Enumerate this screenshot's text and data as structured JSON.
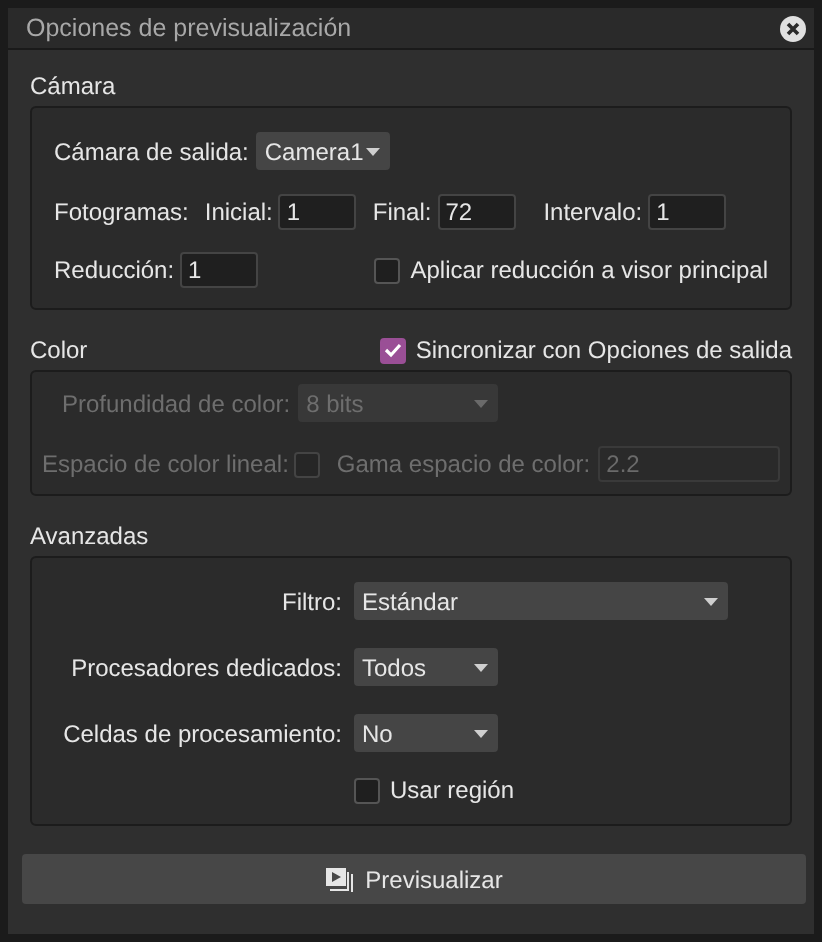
{
  "window": {
    "title": "Opciones de previsualización"
  },
  "camera": {
    "title": "Cámara",
    "output_camera": {
      "label": "Cámara de salida:",
      "value": "Camera1"
    },
    "frames": {
      "label": "Fotogramas:",
      "fields": [
        {
          "label": "Inicial:",
          "value": "1"
        },
        {
          "label": "Final:",
          "value": "72"
        },
        {
          "label": "Intervalo:",
          "value": "1"
        }
      ]
    },
    "reduction": {
      "label": "Reducción:",
      "value": "1"
    },
    "apply_to_viewer": {
      "label": "Aplicar reducción a visor principal",
      "checked": false
    }
  },
  "color": {
    "title": "Color",
    "sync": {
      "label": "Sincronizar con Opciones de salida",
      "checked": true
    },
    "disabled": true,
    "depth": {
      "label": "Profundidad de color:",
      "value": "8 bits"
    },
    "linear": {
      "label": "Espacio de color lineal:",
      "checked": false
    },
    "gamma": {
      "label": "Gama espacio de color:",
      "value": "2.2"
    }
  },
  "advanced": {
    "title": "Avanzadas",
    "dropdowns": [
      {
        "label": "Filtro:",
        "value": "Estándar"
      },
      {
        "label": "Procesadores dedicados:",
        "value": "Todos"
      },
      {
        "label": "Celdas de procesamiento:",
        "value": "No"
      }
    ],
    "use_region": {
      "label": "Usar región",
      "checked": false
    }
  },
  "preview_button": {
    "label": "Previsualizar"
  }
}
